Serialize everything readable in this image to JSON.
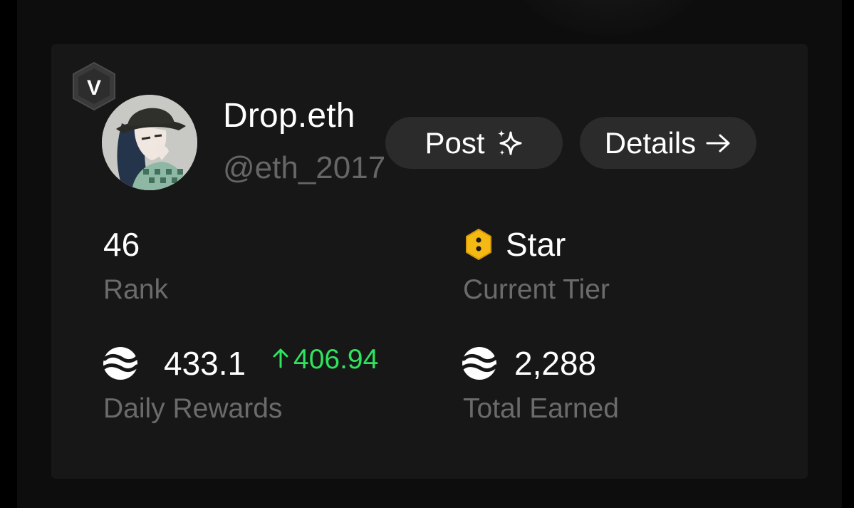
{
  "profile": {
    "display_name": "Drop.eth",
    "handle": "@eth_2017",
    "verified_badge_letter": "V"
  },
  "actions": {
    "post_label": "Post",
    "details_label": "Details"
  },
  "stats": {
    "rank": {
      "value": "46",
      "label": "Rank"
    },
    "tier": {
      "value": "Star",
      "label": "Current Tier"
    },
    "daily_rewards": {
      "value": "433.1",
      "delta": "406.94",
      "label": "Daily Rewards"
    },
    "total_earned": {
      "value": "2,288",
      "label": "Total Earned"
    }
  },
  "icons": {
    "post": "sparkles-icon",
    "details": "arrow-right-icon",
    "tier": "hex-tier-icon",
    "token": "token-swirl-icon",
    "delta": "arrow-up-icon"
  },
  "colors": {
    "background": "#000000",
    "card": "#171717",
    "pill": "#2b2b2b",
    "muted_text": "#6b6b6b",
    "positive": "#2ee35f",
    "tier_gold": "#f5b914"
  }
}
